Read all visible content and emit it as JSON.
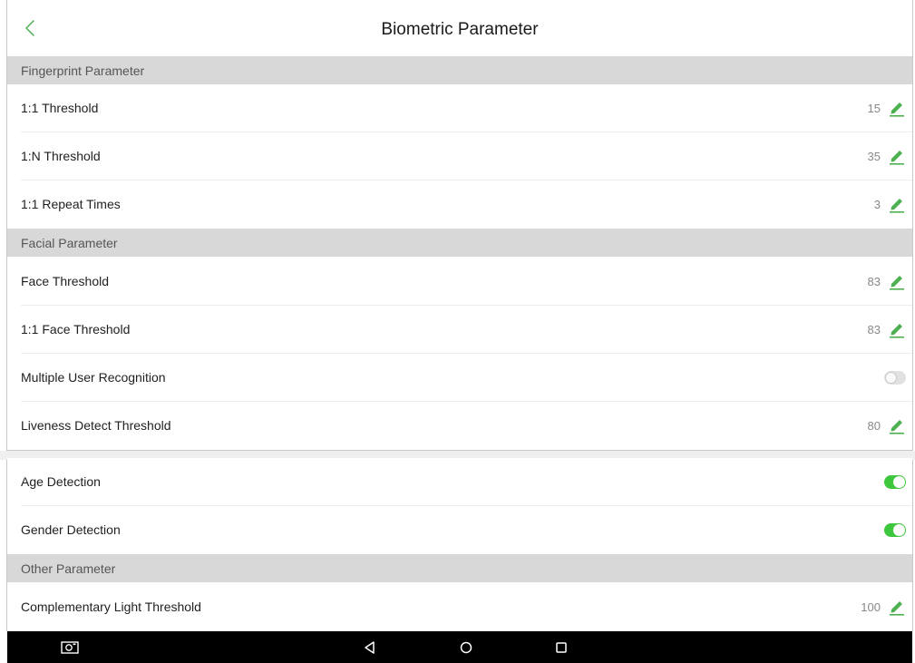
{
  "header": {
    "title": "Biometric Parameter",
    "back_icon": "chevron-left-icon",
    "accent": "#4caf50"
  },
  "sections": {
    "fingerprint": "Fingerprint Parameter",
    "facial": "Facial Parameter",
    "other": "Other Parameter"
  },
  "fingerprint_rows": [
    {
      "label": "1:1 Threshold",
      "value": "15"
    },
    {
      "label": "1:N Threshold",
      "value": "35"
    },
    {
      "label": "1:1 Repeat Times",
      "value": "3"
    }
  ],
  "facial_rows": [
    {
      "label": "Face Threshold",
      "value": "83"
    },
    {
      "label": "1:1 Face Threshold",
      "value": "83"
    },
    {
      "label": "Multiple User Recognition",
      "toggle": false
    },
    {
      "label": "Liveness Detect Threshold",
      "value": "80"
    },
    {
      "label": "Age Detection",
      "toggle": true
    },
    {
      "label": "Gender Detection",
      "toggle": true
    }
  ],
  "other_rows": [
    {
      "label": "Complementary Light Threshold",
      "value": "100"
    }
  ],
  "navbar": {
    "buttons": [
      "screenshot-icon",
      "back-triangle-icon",
      "home-circle-icon",
      "recents-square-icon"
    ]
  },
  "colors": {
    "section_bg": "#d8d8d8",
    "toggle_on": "#3cc73c",
    "edit_icon": "#4caf50",
    "navbar_bg": "#000000"
  }
}
